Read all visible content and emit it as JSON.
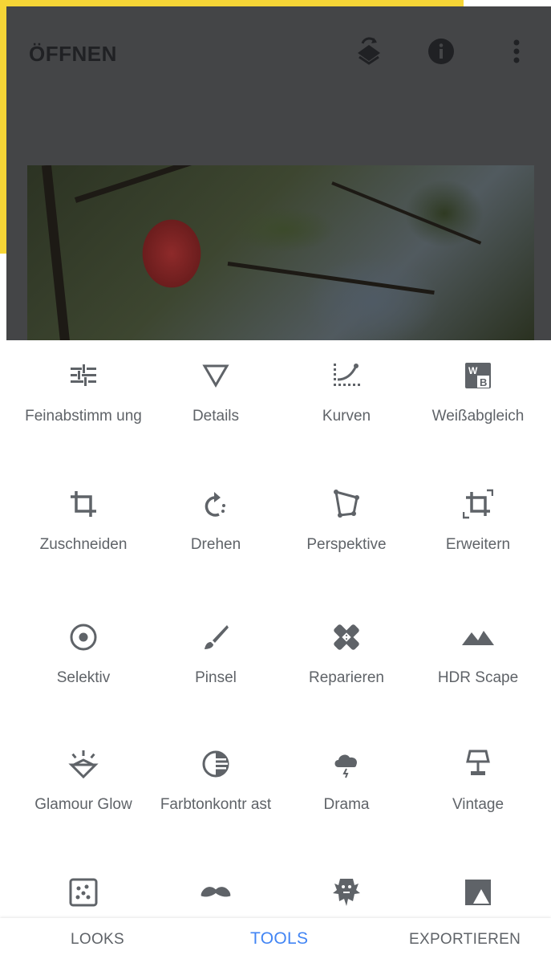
{
  "header": {
    "title": "ÖFFNEN",
    "icons": [
      "layers-undo-icon",
      "info-icon",
      "more-vert-icon"
    ]
  },
  "tools": [
    {
      "label": "Feinabstimm ung",
      "icon": "tune-icon"
    },
    {
      "label": "Details",
      "icon": "details-triangle-icon"
    },
    {
      "label": "Kurven",
      "icon": "curves-icon"
    },
    {
      "label": "Weißabgleich",
      "icon": "white-balance-icon"
    },
    {
      "label": "Zuschneiden",
      "icon": "crop-icon"
    },
    {
      "label": "Drehen",
      "icon": "rotate-icon"
    },
    {
      "label": "Perspektive",
      "icon": "perspective-icon"
    },
    {
      "label": "Erweitern",
      "icon": "expand-icon"
    },
    {
      "label": "Selektiv",
      "icon": "selective-icon"
    },
    {
      "label": "Pinsel",
      "icon": "brush-icon"
    },
    {
      "label": "Reparieren",
      "icon": "healing-icon"
    },
    {
      "label": "HDR Scape",
      "icon": "hdr-mountains-icon"
    },
    {
      "label": "Glamour Glow",
      "icon": "glamour-glow-icon"
    },
    {
      "label": "Farbtonkontr ast",
      "icon": "tonal-contrast-icon"
    },
    {
      "label": "Drama",
      "icon": "drama-cloud-icon"
    },
    {
      "label": "Vintage",
      "icon": "vintage-lamp-icon"
    },
    {
      "label": "",
      "icon": "grainy-film-icon"
    },
    {
      "label": "",
      "icon": "retrolux-mustache-icon"
    },
    {
      "label": "",
      "icon": "grunge-icon"
    },
    {
      "label": "",
      "icon": "black-white-icon"
    }
  ],
  "nav": {
    "looks": "LOOKS",
    "tools": "TOOLS",
    "export": "EXPORTIEREN",
    "active": "TOOLS",
    "active_color": "#4285f4"
  }
}
